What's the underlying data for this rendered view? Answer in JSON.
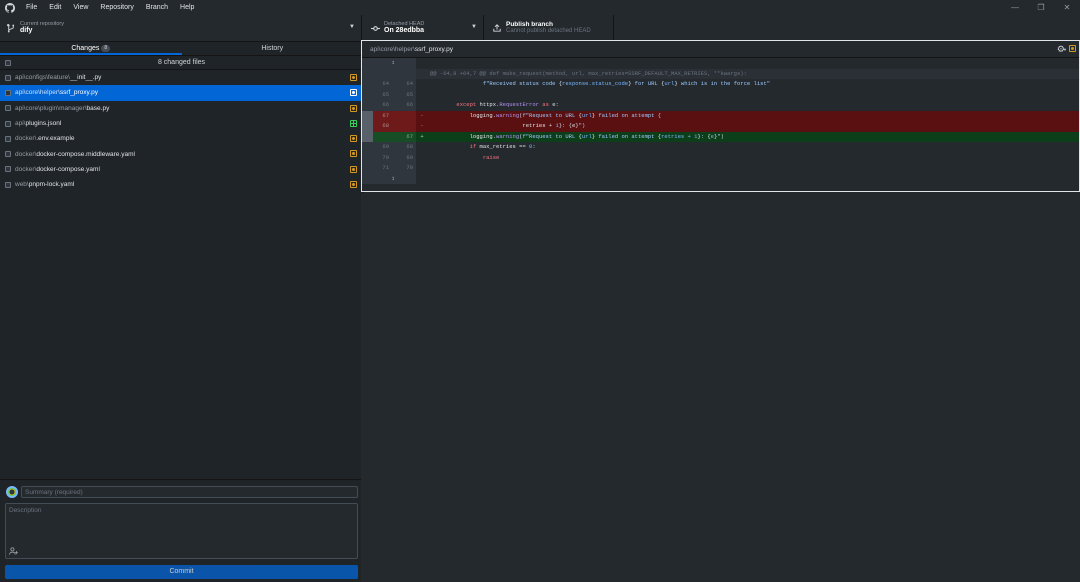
{
  "menu": [
    "File",
    "Edit",
    "View",
    "Repository",
    "Branch",
    "Help"
  ],
  "window_controls": {
    "minimize": "—",
    "restore": "❐",
    "close": "✕"
  },
  "toolbar": {
    "repo_label": "Current repository",
    "repo_value": "dify",
    "branch_label": "Detached HEAD",
    "branch_value": "On 28edbba",
    "publish_label": "Publish branch",
    "publish_sub": "Cannot publish detached HEAD"
  },
  "tabs": {
    "changes": "Changes",
    "changes_count": "8",
    "history": "History"
  },
  "changes_header": "8 changed files",
  "files": [
    {
      "dir": "api\\configs\\feature\\",
      "name": "__init__.py",
      "status": "modified",
      "selected": false
    },
    {
      "dir": "api\\core\\helper\\",
      "name": "ssrf_proxy.py",
      "status": "modified",
      "selected": true
    },
    {
      "dir": "api\\core\\plugin\\manager\\",
      "name": "base.py",
      "status": "modified",
      "selected": false
    },
    {
      "dir": "api\\",
      "name": "plugins.jsonl",
      "status": "added",
      "selected": false
    },
    {
      "dir": "docker\\",
      "name": ".env.example",
      "status": "modified",
      "selected": false
    },
    {
      "dir": "docker\\",
      "name": "docker-compose.middleware.yaml",
      "status": "modified",
      "selected": false
    },
    {
      "dir": "docker\\",
      "name": "docker-compose.yaml",
      "status": "modified",
      "selected": false
    },
    {
      "dir": "web\\",
      "name": "pnpm-lock.yaml",
      "status": "modified",
      "selected": false
    }
  ],
  "commit": {
    "summary_placeholder": "Summary (required)",
    "description_placeholder": "Description",
    "button_label": "Commit"
  },
  "diff": {
    "dir": "api\\core\\helper\\",
    "name": "ssrf_proxy.py",
    "lines": [
      {
        "type": "expand-up",
        "old": "",
        "new": "",
        "code": ""
      },
      {
        "type": "hunk",
        "old": "",
        "new": "",
        "code": "@@ -64,8 +64,7 @@ def make_request(method, url, max_retries=SSRF_DEFAULT_MAX_RETRIES, **kwargs):"
      },
      {
        "type": "ctx",
        "old": "64",
        "new": "64",
        "code": "                f\"Received status code {response.status_code} for URL {url} which is in the force list\""
      },
      {
        "type": "ctx",
        "old": "65",
        "new": "65",
        "code": ""
      },
      {
        "type": "ctx",
        "old": "66",
        "new": "66",
        "code": "        except httpx.RequestError as e:"
      },
      {
        "type": "del",
        "old": "67",
        "new": "",
        "code": "            logging.warning(f\"Request to URL {url} failed on attempt {"
      },
      {
        "type": "del",
        "old": "68",
        "new": "",
        "code": "                            retries + 1}: {e}\")"
      },
      {
        "type": "add",
        "old": "",
        "new": "67",
        "code": "            logging.warning(f\"Request to URL {url} failed on attempt {retries + 1}: {e}\")"
      },
      {
        "type": "ctx",
        "old": "69",
        "new": "68",
        "code": "            if max_retries == 0:"
      },
      {
        "type": "ctx",
        "old": "70",
        "new": "69",
        "code": "                raise"
      },
      {
        "type": "ctx",
        "old": "71",
        "new": "70",
        "code": ""
      },
      {
        "type": "expand-down",
        "old": "",
        "new": "",
        "code": ""
      }
    ]
  },
  "colors": {
    "accent": "#0366d6",
    "modified": "#d29922",
    "added": "#34d058",
    "deleted_bg": "#5a1010",
    "added_bg": "#0d3e1a"
  }
}
